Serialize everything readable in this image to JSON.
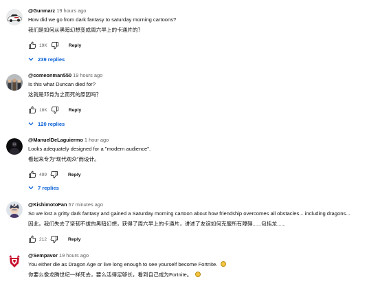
{
  "comments": [
    {
      "author": "@Gunmarz",
      "time": "19 hours ago",
      "text": "How did we go from dark fantasy to saturday morning cartoons?",
      "translation": "我们是如何从黑暗幻想变成周六早上的卡通片的？",
      "likes": "19K",
      "reply_label": "Reply",
      "replies_label": "239 replies",
      "avatar": "car-avatar"
    },
    {
      "author": "@comeonman550",
      "time": "19 hours ago",
      "text": "Is this what Duncan died for?",
      "translation": "这就是邓肯为之而死的原因吗？",
      "likes": "18K",
      "reply_label": "Reply",
      "replies_label": "120 replies",
      "avatar": "group-avatar"
    },
    {
      "author": "@ManuelDeLaguiermo",
      "time": "1 hour ago",
      "text": "Looks adequately designed for a \"modern audience\".",
      "translation": "看起来专为“现代观众”而设计。",
      "likes": "499",
      "reply_label": "Reply",
      "replies_label": "7 replies",
      "avatar": "dark-figure-avatar"
    },
    {
      "author": "@KishimotoFan",
      "time": "57 minutes ago",
      "text": "So we lost a gritty dark fantasy and gained a Saturday morning cartoon about how friendship overcomes all obstacles... including dragons...",
      "translation": "因此，我们失去了坚韧不拔的黑暗幻想，获得了周六早上的卡通片，讲述了友谊如何克服所有障碍......包括龙......",
      "likes": "212",
      "reply_label": "Reply",
      "avatar": "anime-avatar"
    },
    {
      "author": "@Sempavor",
      "time": "19 hours ago",
      "text": "You either die as Dragon Age or live long enough to see yourself become Fortnite.",
      "translation": "你要么像龙腾世纪一样死去，要么活得足够长，看到自己成为Fortnite。",
      "avatar": "red-emblem-avatar"
    }
  ],
  "colors": {
    "link": "#065fd4",
    "secondary": "#606060",
    "text": "#0f0f0f"
  },
  "icons": [
    "like-icon",
    "dislike-icon",
    "chevron-down-icon",
    "grimace-emoji"
  ]
}
